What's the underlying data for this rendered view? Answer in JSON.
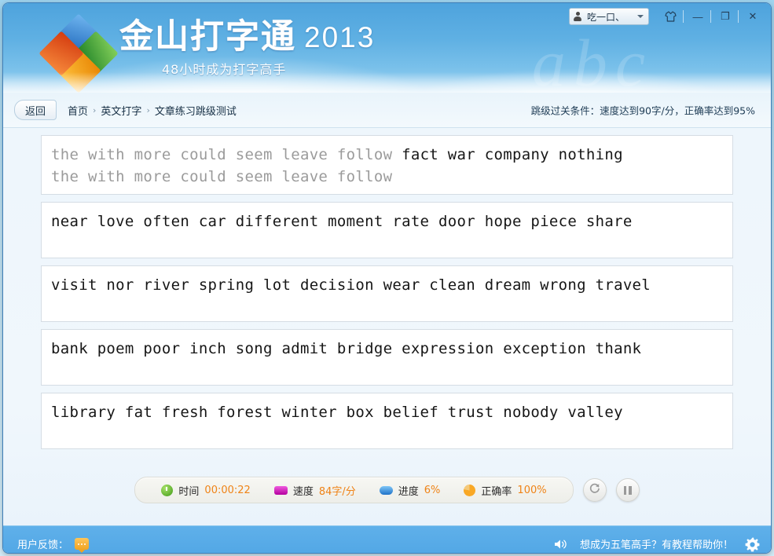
{
  "titlebar": {
    "user_name": "吃一口、",
    "user_icon": "person-icon",
    "dropdown_icon": "chevron-down-icon",
    "skin_icon": "shirt-icon",
    "minimize_label": "—",
    "maximize_label": "❐",
    "close_label": "✕"
  },
  "brand": {
    "title": "金山打字通",
    "year": "2013",
    "slogan": "48小时成为打字高手",
    "ghost": "abc",
    "logo_icon": "pinwheel-logo-icon"
  },
  "nav": {
    "back_label": "返回",
    "crumbs": [
      {
        "label": "首页"
      },
      {
        "label": "英文打字"
      },
      {
        "label": "文章练习跳级测试"
      }
    ],
    "separator": "›",
    "pass_condition": "跳级过关条件：速度达到90字/分，正确率达到95%"
  },
  "practice": {
    "panels": [
      {
        "typed": "the with more could seem leave follow ",
        "untyped": "fact war company nothing",
        "echo": "the with more could seem leave follow"
      },
      {
        "typed": "",
        "untyped": "near love often car different moment rate door hope piece share",
        "echo": ""
      },
      {
        "typed": "",
        "untyped": "visit nor river spring lot decision wear clean dream wrong travel",
        "echo": ""
      },
      {
        "typed": "",
        "untyped": "bank poem poor inch song admit bridge expression exception thank",
        "echo": ""
      },
      {
        "typed": "",
        "untyped": "library fat fresh forest winter box belief trust nobody valley",
        "echo": ""
      }
    ]
  },
  "stats": {
    "time_label": "时间",
    "time_value": "00:00:22",
    "speed_label": "速度",
    "speed_value": "84字/分",
    "progress_label": "进度",
    "progress_value": "6%",
    "accuracy_label": "正确率",
    "accuracy_value": "100%",
    "restart_icon": "restart-icon",
    "pause_icon": "pause-icon",
    "value_color": "#ef8316"
  },
  "footer": {
    "feedback_label": "用户反馈：",
    "feedback_icon": "speech-bubble-icon",
    "speaker_icon": "speaker-icon",
    "promo_text": "想成为五笔高手？有教程帮助你！",
    "settings_icon": "gear-icon"
  }
}
